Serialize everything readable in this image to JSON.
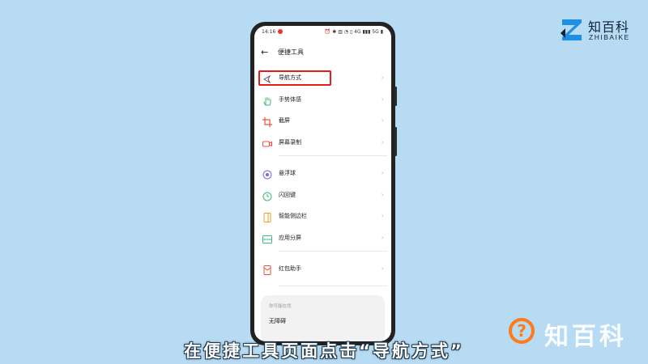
{
  "brand": {
    "name": "知百科",
    "pinyin": "ZHIBAIKE"
  },
  "status_bar": {
    "time": "14:16",
    "icons_text": "⏰ ✱ ▥ ◔ ▯ 4G ▮▮▮ 5G ▮"
  },
  "page": {
    "title": "便捷工具"
  },
  "menu_groups": [
    [
      {
        "label": "导航方式",
        "icon": "navigation-triangle-icon",
        "highlighted": true
      },
      {
        "label": "手势体感",
        "icon": "hand-gesture-icon"
      },
      {
        "label": "截屏",
        "icon": "crop-icon"
      },
      {
        "label": "屏幕录制",
        "icon": "screen-record-icon"
      }
    ],
    [
      {
        "label": "悬浮球",
        "icon": "floating-ball-icon"
      },
      {
        "label": "闪回键",
        "icon": "flashback-key-icon"
      },
      {
        "label": "智能侧边栏",
        "icon": "smart-sidebar-icon"
      },
      {
        "label": "应用分屏",
        "icon": "split-screen-icon"
      }
    ],
    [
      {
        "label": "红包助手",
        "icon": "red-envelope-icon"
      }
    ]
  ],
  "bottom_card": {
    "subtitle": "你可能在找",
    "item": "无障碍"
  },
  "caption": "在便捷工具页面点击“导航方式”",
  "watermark": {
    "symbol": "?",
    "name": "知百科"
  },
  "colors": {
    "background": "#b6dbf2",
    "highlight": "#e81919",
    "watermark_accent": "#ff7a1a"
  }
}
